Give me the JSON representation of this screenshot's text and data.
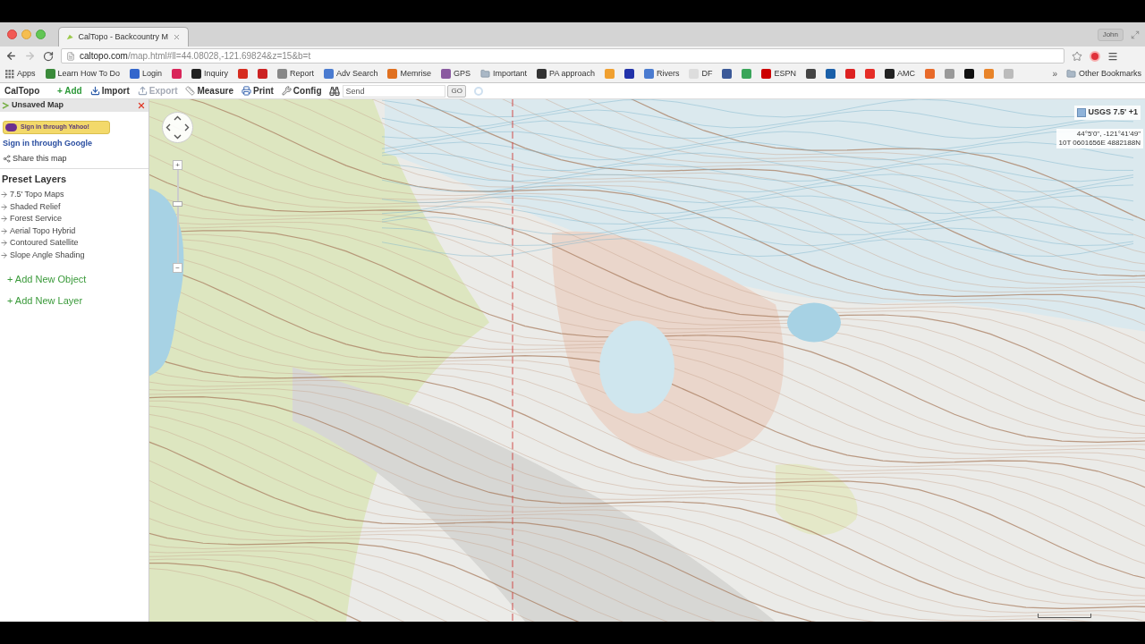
{
  "browser": {
    "tabs": [
      {
        "title": "CalTopo - Backcountry M",
        "selected": true
      }
    ],
    "profile": "John",
    "url": {
      "host": "caltopo.com",
      "path": "/map.html#ll=44.08028,-121.69824&z=15&b=t"
    },
    "bookmarks": [
      {
        "kind": "apps",
        "label": "Apps"
      },
      {
        "kind": "site",
        "label": "Learn How To Do",
        "color": "#3a8a3a"
      },
      {
        "kind": "site",
        "label": "Login",
        "color": "#3366cc"
      },
      {
        "kind": "site",
        "color": "#d9265a"
      },
      {
        "kind": "site",
        "label": "Inquiry",
        "color": "#222222"
      },
      {
        "kind": "site",
        "color": "#d62d20"
      },
      {
        "kind": "site",
        "color": "#cc2222"
      },
      {
        "kind": "site",
        "label": "Report",
        "color": "#888888"
      },
      {
        "kind": "site",
        "label": "Adv Search",
        "color": "#4a7bd0"
      },
      {
        "kind": "site",
        "label": "Memrise",
        "color": "#e07020"
      },
      {
        "kind": "site",
        "label": "GPS",
        "color": "#8a5aa0"
      },
      {
        "kind": "folder",
        "label": "Important"
      },
      {
        "kind": "site",
        "label": "PA approach",
        "color": "#333333"
      },
      {
        "kind": "site",
        "color": "#f0a030"
      },
      {
        "kind": "site",
        "color": "#2233aa"
      },
      {
        "kind": "site",
        "label": "Rivers",
        "color": "#4a7bd0"
      },
      {
        "kind": "site",
        "label": "DF",
        "color": "#dddddd"
      },
      {
        "kind": "site",
        "color": "#3b5998"
      },
      {
        "kind": "site",
        "color": "#3aa55a"
      },
      {
        "kind": "site",
        "label": "ESPN",
        "color": "#cc0000"
      },
      {
        "kind": "site",
        "color": "#444444"
      },
      {
        "kind": "site",
        "color": "#1a5fa8"
      },
      {
        "kind": "site",
        "color": "#dd2222"
      },
      {
        "kind": "site",
        "color": "#e52d27"
      },
      {
        "kind": "site",
        "label": "AMC",
        "color": "#222222"
      },
      {
        "kind": "site",
        "color": "#e86a2a"
      },
      {
        "kind": "site",
        "color": "#999999"
      },
      {
        "kind": "site",
        "color": "#111111"
      },
      {
        "kind": "site",
        "color": "#e8842a"
      },
      {
        "kind": "site",
        "color": "#bbbbbb"
      }
    ],
    "bookmarks_overflow": "»",
    "other_bookmarks": "Other Bookmarks"
  },
  "toolbar": {
    "brand": "CalTopo",
    "buttons": [
      {
        "kind": "add",
        "label": "+ Add",
        "disabled": false
      },
      {
        "kind": "import",
        "label": "Import",
        "disabled": false
      },
      {
        "kind": "export",
        "label": "Export",
        "disabled": true
      },
      {
        "kind": "measure",
        "label": "Measure",
        "disabled": false
      },
      {
        "kind": "print",
        "label": "Print",
        "disabled": false
      },
      {
        "kind": "config",
        "label": "Config",
        "disabled": false
      }
    ],
    "search": {
      "value": "Send"
    },
    "go_button": "GO"
  },
  "sidebar": {
    "title": "Unsaved Map",
    "yahoo_button": "Sign in through Yahoo!",
    "google_link": "Sign in through Google",
    "share_link": "Share this map",
    "preset_layers": {
      "heading": "Preset Layers",
      "items": [
        "7.5' Topo Maps",
        "Shaded Relief",
        "Forest Service",
        "Aerial Topo Hybrid",
        "Contoured Satellite",
        "Slope Angle Shading"
      ]
    },
    "actions": [
      "+ Add New Object",
      "+ Add New Layer"
    ]
  },
  "map": {
    "zoom_in": "+",
    "zoom_out": "−",
    "zoom_slider": {
      "level": 0.63
    },
    "layer_control": "USGS 7.5' +1",
    "coordinates": {
      "latlon": "44°5'0\", -121°41'49\"",
      "utm": "10T 0601656E 4882188N"
    }
  }
}
